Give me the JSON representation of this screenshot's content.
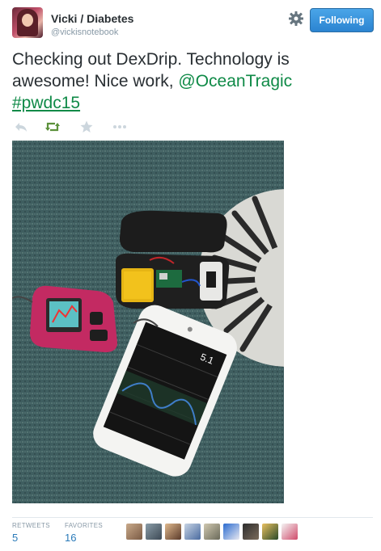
{
  "author": {
    "display_name": "Vicki / Diabetes",
    "username": "@vickisnotebook"
  },
  "follow_button": {
    "label": "Following"
  },
  "tweet": {
    "text_main": "Checking out DexDrip. Technology is awesome! Nice work, ",
    "mention": "@OceanTragic",
    "hashtag": "#pwdc15"
  },
  "photo_screen": {
    "reading": "5.1"
  },
  "stats": {
    "retweets_label": "RETWEETS",
    "retweets_value": "5",
    "favorites_label": "FAVORITES",
    "favorites_value": "16"
  },
  "icons": [
    "gear-icon",
    "reply-icon",
    "retweet-icon",
    "favorite-icon",
    "more-icon"
  ],
  "colors": {
    "follow_button": "#2b84d1",
    "link": "#0f8a47",
    "stat_value": "#2b7bb9",
    "retweet_active": "#5c913b"
  }
}
